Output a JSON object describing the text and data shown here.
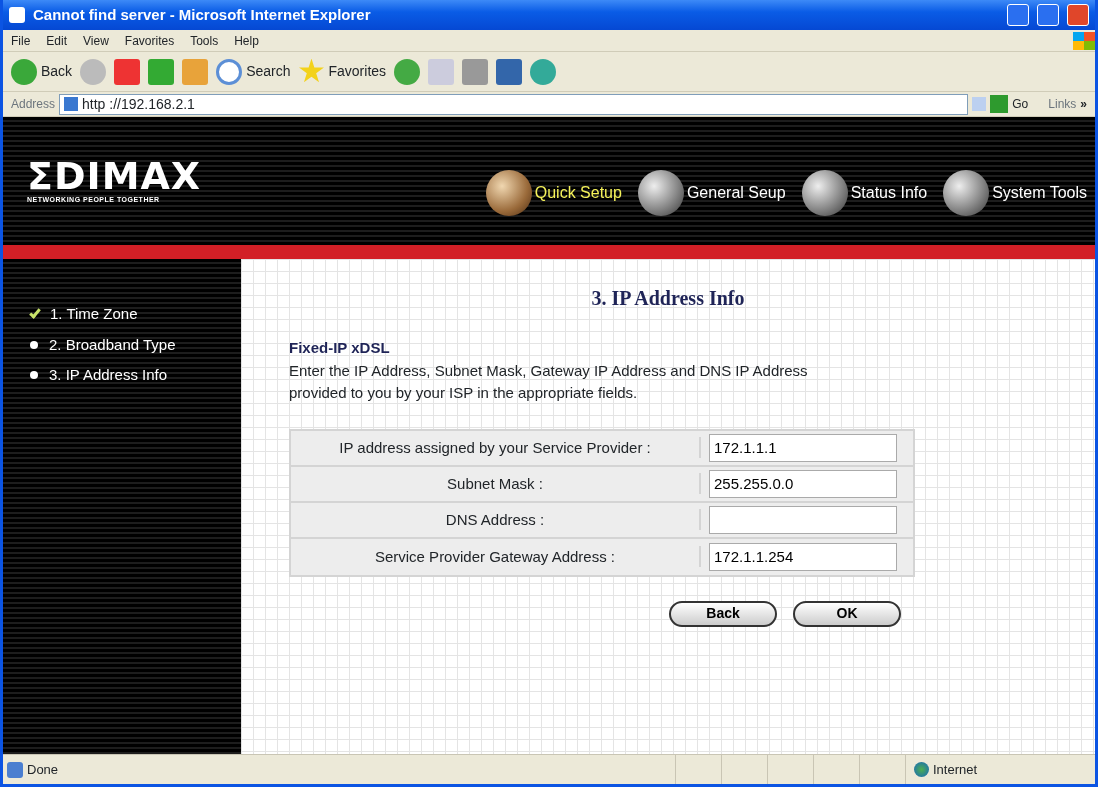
{
  "window": {
    "title": "Cannot find server - Microsoft Internet Explorer"
  },
  "menu": [
    "File",
    "Edit",
    "View",
    "Favorites",
    "Tools",
    "Help"
  ],
  "toolbar": {
    "back": "Back",
    "search": "Search",
    "favorites": "Favorites"
  },
  "address_bar": {
    "label": "Address",
    "url": "http ://192.168.2.1",
    "go": "Go",
    "links": "Links",
    "more": "»"
  },
  "logo": {
    "name": "ΣDIMAX",
    "tagline": "NETWORKING PEOPLE TOGETHER"
  },
  "nav_tabs": [
    {
      "label": "Quick Setup",
      "selected": true
    },
    {
      "label": "General Seup",
      "selected": false
    },
    {
      "label": "Status Info",
      "selected": false
    },
    {
      "label": "System Tools",
      "selected": false
    }
  ],
  "steps": [
    {
      "label": "1. Time Zone",
      "done": true
    },
    {
      "label": "2. Broadband Type",
      "done": false
    },
    {
      "label": "3. IP Address Info",
      "done": false
    }
  ],
  "heading": "3. IP Address Info",
  "subheading": "Fixed-IP xDSL",
  "description": "Enter the IP Address, Subnet Mask, Gateway IP Address and DNS IP Address provided to you by your ISP in the appropriate fields.",
  "fields": [
    {
      "label": "IP address assigned by your Service Provider :",
      "value": "172.1.1.1"
    },
    {
      "label": "Subnet Mask :",
      "value": "255.255.0.0"
    },
    {
      "label": "DNS Address :"
    },
    {
      "label": "Service Provider Gateway Address :",
      "value": "172.1.1.254"
    }
  ],
  "buttons": [
    "Back",
    "OK"
  ],
  "status_bar": {
    "text": "Done",
    "zone": "Internet"
  }
}
